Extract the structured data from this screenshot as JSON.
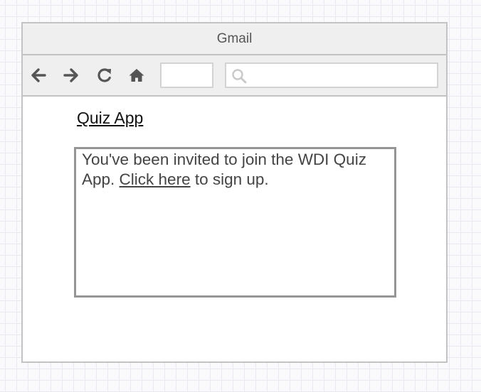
{
  "window": {
    "title": "Gmail"
  },
  "toolbar": {
    "icons": [
      "back-arrow-icon",
      "forward-arrow-icon",
      "refresh-icon",
      "home-icon",
      "search-icon"
    ],
    "url_value": "",
    "search_value": ""
  },
  "page": {
    "link_label": "Quiz App",
    "email": {
      "text_before": "You've been invited to join the WDI Quiz App. ",
      "link_text": "Click here",
      "text_after": " to sign up."
    }
  },
  "colors": {
    "border": "#c3c3c3",
    "bar_background": "#efefef",
    "icon": "#555555",
    "grid": "#e9e9f2"
  }
}
